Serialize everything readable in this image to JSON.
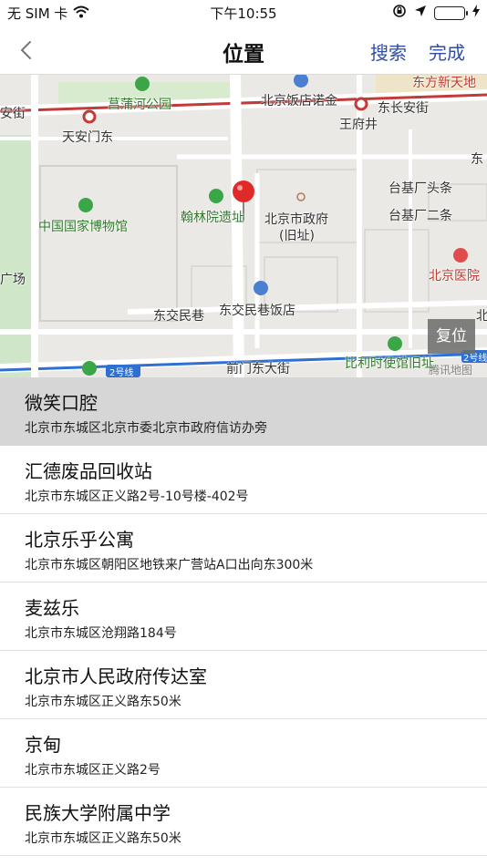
{
  "status_bar": {
    "carrier": "无 SIM 卡",
    "time": "下午10:55",
    "battery_color": "#3cc94c"
  },
  "nav": {
    "title": "位置",
    "search_label": "搜索",
    "done_label": "完成",
    "accent_color": "#2f4ea3"
  },
  "map": {
    "labels": {
      "east_chang_an": "东方新天地",
      "changpu_park": "菖蒲河公园",
      "beijing_hotel": "北京饭店诺金",
      "dongchang_an": "东长安街",
      "chang_an_jie": "安街",
      "wangfujing": "王府井",
      "tiananmen_east": "天安门东",
      "dong": "东",
      "taijichang_tou": "台基厂头条",
      "hanlin": "翰林院遗址",
      "govt_old": "北京市政府",
      "govt_old_2": "(旧址)",
      "taijichang_2": "台基厂二条",
      "national_museum": "中国国家博物馆",
      "beijing_hospital": "北京医院",
      "guang_chang": "广场",
      "dongjiao_minxiang": "东交民巷",
      "dongjiao_hotel": "东交民巷饭店",
      "bei": "北",
      "line2": "2号线",
      "line2_right": "2号线",
      "qianmen_east": "前门东大街",
      "belgian_embassy": "比利时使馆旧址"
    },
    "reset_label": "复位",
    "watermark": "腾讯地图"
  },
  "places": [
    {
      "name": "微笑口腔",
      "address": "北京市东城区北京市委北京市政府信访办旁",
      "selected": true
    },
    {
      "name": "汇德废品回收站",
      "address": "北京市东城区正义路2号-10号楼-402号",
      "selected": false
    },
    {
      "name": "北京乐乎公寓",
      "address": "北京市东城区朝阳区地铁来广营站A口出向东300米",
      "selected": false
    },
    {
      "name": "麦兹乐",
      "address": "北京市东城区沧翔路184号",
      "selected": false
    },
    {
      "name": "北京市人民政府传达室",
      "address": "北京市东城区正义路东50米",
      "selected": false
    },
    {
      "name": "京甸",
      "address": "北京市东城区正义路2号",
      "selected": false
    },
    {
      "name": "民族大学附属中学",
      "address": "北京市东城区正义路东50米",
      "selected": false
    }
  ]
}
